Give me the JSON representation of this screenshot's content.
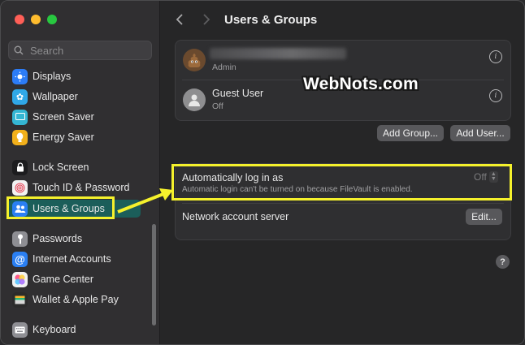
{
  "window": {
    "title": "Users & Groups"
  },
  "search": {
    "placeholder": "Search"
  },
  "sidebar": {
    "items": [
      {
        "label": "Displays",
        "icon": "display-icon",
        "color": "#2c7cf6"
      },
      {
        "label": "Wallpaper",
        "icon": "wallpaper-icon",
        "color": "#30a8e8"
      },
      {
        "label": "Screen Saver",
        "icon": "screen-saver-icon",
        "color": "#34b6d3"
      },
      {
        "label": "Energy Saver",
        "icon": "energy-saver-icon",
        "color": "#f2b01b"
      },
      {
        "label": "Lock Screen",
        "icon": "lock-icon",
        "color": "#1c1c1e"
      },
      {
        "label": "Touch ID & Password",
        "icon": "fingerprint-icon",
        "color": "#f2f2f2"
      },
      {
        "label": "Users & Groups",
        "icon": "users-icon",
        "color": "#2a7ff3"
      },
      {
        "label": "Passwords",
        "icon": "key-icon",
        "color": "#8e8e93"
      },
      {
        "label": "Internet Accounts",
        "icon": "at-icon",
        "color": "#2a7ff3"
      },
      {
        "label": "Game Center",
        "icon": "game-center-icon",
        "color": "#f2f2f2"
      },
      {
        "label": "Wallet & Apple Pay",
        "icon": "wallet-icon",
        "color": "#2b2b2b"
      },
      {
        "label": "Keyboard",
        "icon": "keyboard-icon",
        "color": "#8e8e93"
      }
    ]
  },
  "users": [
    {
      "name": "",
      "role": "Admin",
      "avatar": "poop-emoji-icon"
    },
    {
      "name": "Guest User",
      "role": "Off",
      "avatar": "person-icon"
    }
  ],
  "buttons": {
    "add_group": "Add Group...",
    "add_user": "Add User...",
    "edit": "Edit..."
  },
  "auto_login": {
    "label": "Automatically log in as",
    "description": "Automatic login can't be turned on because FileVault is enabled.",
    "value": "Off"
  },
  "network": {
    "label": "Network account server"
  },
  "help": "?",
  "watermark": "WebNots.com",
  "colors": {
    "highlight": "#f5f12c",
    "selected": "#1b5e5a"
  }
}
